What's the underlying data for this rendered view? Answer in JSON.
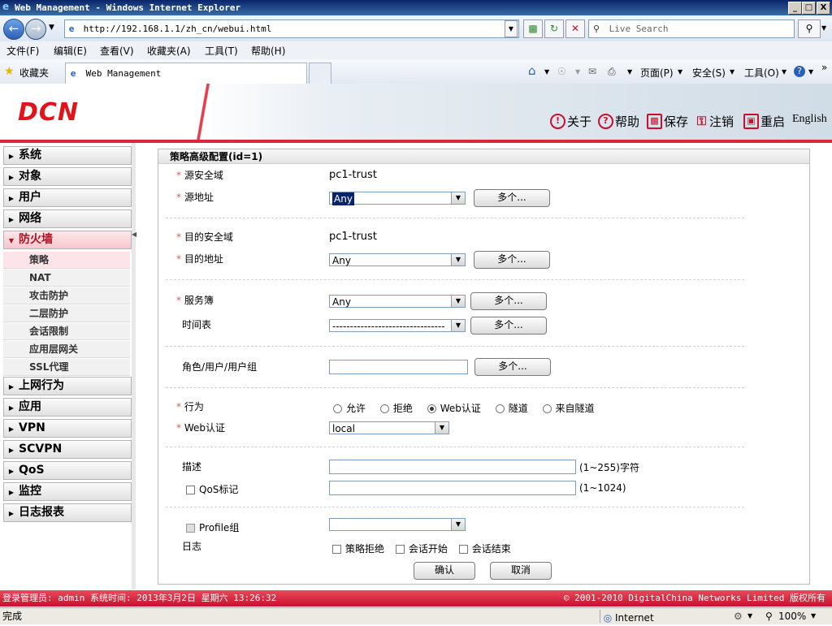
{
  "window": {
    "title": "Web Management - Windows Internet Explorer",
    "min": "_",
    "max": "□",
    "close": "X"
  },
  "address": {
    "url": "http://192.168.1.1/zh_cn/webui.html",
    "search_placeholder": "Live Search"
  },
  "menu": [
    "文件(F)",
    "编辑(E)",
    "查看(V)",
    "收藏夹(A)",
    "工具(T)",
    "帮助(H)"
  ],
  "favbar": {
    "favorites": "收藏夹",
    "tab_title": "Web Management",
    "page": "页面(P)",
    "safety": "安全(S)",
    "tools": "工具(O)"
  },
  "header": {
    "logo": "DCN",
    "links": {
      "about": "关于",
      "help": "帮助",
      "save": "保存",
      "logout": "注销",
      "reboot": "重启",
      "english": "English"
    }
  },
  "sidebar": {
    "items_top": [
      "系统",
      "对象",
      "用户",
      "网络",
      "防火墙"
    ],
    "sub": [
      "策略",
      "NAT",
      "攻击防护",
      "二层防护",
      "会话限制",
      "应用层网关",
      "SSL代理"
    ],
    "items_bottom": [
      "上网行为",
      "应用",
      "VPN",
      "SCVPN",
      "QoS",
      "监控",
      "日志报表"
    ]
  },
  "form": {
    "title": "策略高级配置(id=1)",
    "src_zone_label": "源安全域",
    "src_zone_value": "pc1-trust",
    "src_addr_label": "源地址",
    "src_addr_value": "Any",
    "dst_zone_label": "目的安全域",
    "dst_zone_value": "pc1-trust",
    "dst_addr_label": "目的地址",
    "dst_addr_value": "Any",
    "service_label": "服务簿",
    "service_value": "Any",
    "schedule_label": "时间表",
    "schedule_value": "--------------------------------",
    "role_label": "角色/用户/用户组",
    "more_label": "多个...",
    "action_label": "行为",
    "action_options": [
      "允许",
      "拒绝",
      "Web认证",
      "隧道",
      "来自隧道"
    ],
    "action_selected": "Web认证",
    "webauth_label": "Web认证",
    "webauth_value": "local",
    "desc_label": "描述",
    "desc_hint": "(1~255)字符",
    "qos_label": "QoS标记",
    "qos_hint": "(1~1024)",
    "profile_label": "Profile组",
    "log_label": "日志",
    "log_options": [
      "策略拒绝",
      "会话开始",
      "会话结束"
    ],
    "ok": "确认",
    "cancel": "取消"
  },
  "footer": {
    "left": "登录管理员: admin 系统时间: 2013年3月2日 星期六 13:26:32",
    "right": "© 2001-2010 DigitalChina Networks Limited 版权所有"
  },
  "status": {
    "left": "完成",
    "zone": "Internet",
    "zoom": "100%"
  },
  "colors": {
    "brand_red": "#c8102e",
    "selection_blue": "#0a246a"
  }
}
